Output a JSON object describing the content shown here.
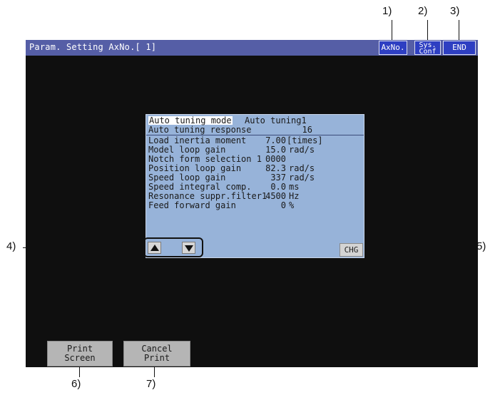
{
  "callouts": [
    "1)",
    "2)",
    "3)",
    "4)",
    "5)",
    "6)",
    "7)"
  ],
  "titlebar": {
    "title": "Param. Setting AxNo.[ 1]",
    "axno_label": "AxNo.",
    "sysconf_line1": "Sys.",
    "sysconf_line2": "Conf",
    "end_label": "END"
  },
  "params": [
    {
      "label": "Auto tuning response",
      "value": "16",
      "unit": ""
    },
    {
      "label": "Load inertia moment",
      "value": "7.00",
      "unit": "[times]"
    },
    {
      "label": "Model loop gain",
      "value": "15.0",
      "unit": "rad/s"
    },
    {
      "label": "Notch form selection 1",
      "value": "0000",
      "unit": ""
    },
    {
      "label": "Position loop gain",
      "value": "82.3",
      "unit": "rad/s"
    },
    {
      "label": "Speed loop gain",
      "value": "337",
      "unit": "rad/s"
    },
    {
      "label": "Speed integral comp.",
      "value": "0.0",
      "unit": "ms"
    },
    {
      "label": "Resonance suppr.filter1",
      "value": "4500",
      "unit": "Hz"
    },
    {
      "label": "Feed forward gain",
      "value": "0",
      "unit": "%"
    }
  ],
  "mode_row": {
    "label": "Auto tuning mode",
    "value": "Auto tuning1"
  },
  "chg_label": "CHG",
  "print_screen": {
    "line1": "Print",
    "line2": "Screen"
  },
  "cancel_print": {
    "line1": "Cancel",
    "line2": "Print"
  },
  "colors": {
    "titlebar": "#555ea6",
    "panel": "#97b3d9",
    "screen": "#0f0f0f",
    "button": "#2e3fc2"
  }
}
